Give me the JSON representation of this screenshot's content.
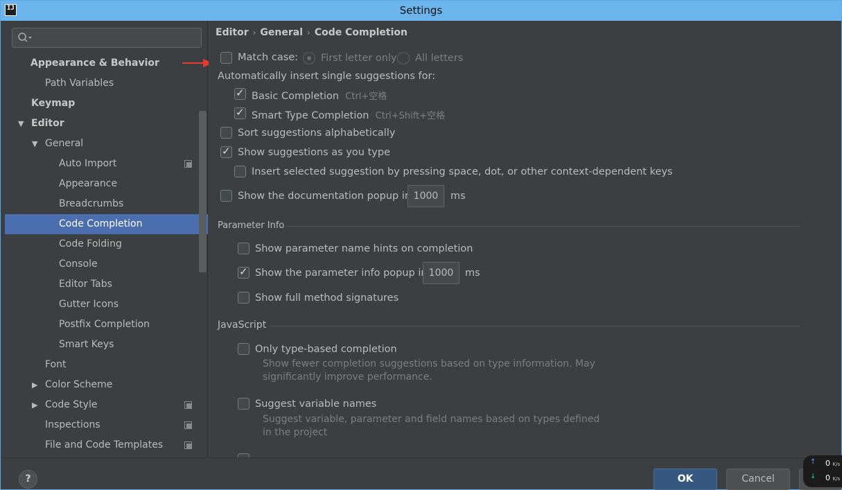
{
  "window": {
    "title": "Settings",
    "app_icon": "IJ"
  },
  "search": {
    "placeholder": ""
  },
  "sidebar": {
    "items": [
      {
        "label": "Appearance & Behavior"
      },
      {
        "label": "Path Variables"
      },
      {
        "label": "Keymap"
      },
      {
        "label": "Editor"
      },
      {
        "label": "General"
      },
      {
        "label": "Auto Import"
      },
      {
        "label": "Appearance"
      },
      {
        "label": "Breadcrumbs"
      },
      {
        "label": "Code Completion"
      },
      {
        "label": "Code Folding"
      },
      {
        "label": "Console"
      },
      {
        "label": "Editor Tabs"
      },
      {
        "label": "Gutter Icons"
      },
      {
        "label": "Postfix Completion"
      },
      {
        "label": "Smart Keys"
      },
      {
        "label": "Font"
      },
      {
        "label": "Color Scheme"
      },
      {
        "label": "Code Style"
      },
      {
        "label": "Inspections"
      },
      {
        "label": "File and Code Templates"
      }
    ]
  },
  "breadcrumb": [
    "Editor",
    "General",
    "Code Completion"
  ],
  "settings": {
    "match_case": "Match case:",
    "first_letter": "First letter only",
    "all_letters": "All letters",
    "auto_insert": "Automatically insert single suggestions for:",
    "basic": "Basic Completion",
    "basic_shortcut": "Ctrl+空格",
    "smart": "Smart Type Completion",
    "smart_shortcut": "Ctrl+Shift+空格",
    "sort_alpha": "Sort suggestions alphabetically",
    "show_as_type": "Show suggestions as you type",
    "insert_selected": "Insert selected suggestion by pressing space, dot, or other context-dependent keys",
    "doc_popup": "Show the documentation popup in",
    "doc_popup_value": "1000",
    "ms": "ms"
  },
  "parameter_info": {
    "title": "Parameter Info",
    "name_hints": "Show parameter name hints on completion",
    "info_popup": "Show the parameter info popup in",
    "info_popup_value": "1000",
    "ms": "ms",
    "full_signatures": "Show full method signatures"
  },
  "javascript": {
    "title": "JavaScript",
    "type_based": "Only type-based completion",
    "type_based_desc": "Show fewer completion suggestions based on type information. May significantly improve performance.",
    "suggest_var": "Suggest variable names",
    "suggest_var_desc": "Suggest variable, parameter and field names based on types defined in the project"
  },
  "footer": {
    "help": "?",
    "ok": "OK",
    "cancel": "Cancel"
  },
  "net": {
    "up": "0",
    "down": "0",
    "unit": "K/s"
  },
  "colors": {
    "selection": "#4b6eaf",
    "accent_button": "#365880",
    "arrow": "#e8382f"
  }
}
